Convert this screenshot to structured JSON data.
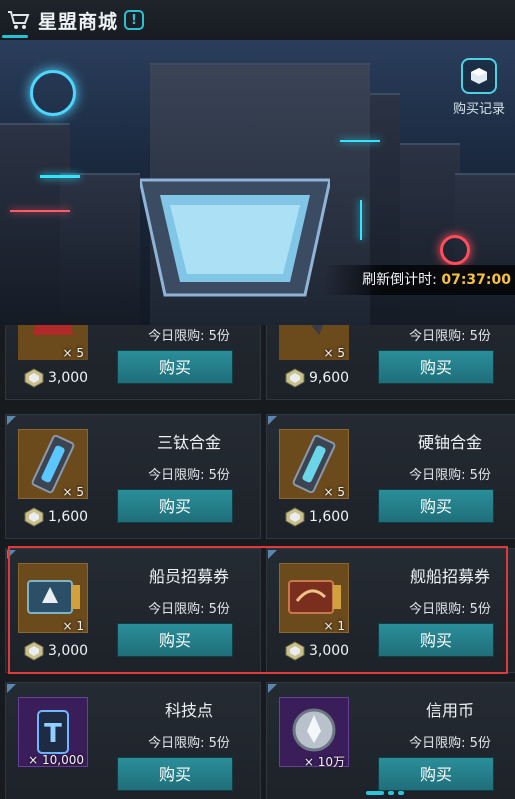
{
  "header": {
    "title": "星盟商城",
    "info_symbol": "!"
  },
  "banner": {
    "purchase_record_label": "购买记录",
    "refresh_label": "刷新倒计时:",
    "refresh_time": "07:37:00"
  },
  "items": [
    {
      "name": "",
      "qty": "× 5",
      "limit": "今日限购: 5份",
      "price": "3,000",
      "buy": "购买",
      "icon": "red-armor-part-icon"
    },
    {
      "name": "",
      "qty": "× 5",
      "limit": "今日限购: 5份",
      "price": "9,600",
      "buy": "购买",
      "icon": "claw-part-icon"
    },
    {
      "name": "三钛合金",
      "qty": "× 5",
      "limit": "今日限购: 5份",
      "price": "1,600",
      "buy": "购买",
      "icon": "titanium-alloy-icon"
    },
    {
      "name": "硬铀合金",
      "qty": "× 5",
      "limit": "今日限购: 5份",
      "price": "1,600",
      "buy": "购买",
      "icon": "uranium-alloy-icon"
    },
    {
      "name": "船员招募券",
      "qty": "× 1",
      "limit": "今日限购: 5份",
      "price": "3,000",
      "buy": "购买",
      "icon": "crew-ticket-icon"
    },
    {
      "name": "舰船招募券",
      "qty": "× 1",
      "limit": "今日限购: 5份",
      "price": "3,000",
      "buy": "购买",
      "icon": "ship-ticket-icon"
    },
    {
      "name": "科技点",
      "qty": "× 10,000",
      "limit": "今日限购: 5份",
      "price": "",
      "buy": "购买",
      "icon": "tech-point-icon"
    },
    {
      "name": "信用币",
      "qty": "× 10万",
      "limit": "今日限购: 5份",
      "price": "",
      "buy": "购买",
      "icon": "credit-coin-icon"
    }
  ],
  "colors": {
    "accent": "#22c3d9",
    "button": "#2a8f9a",
    "timer": "#f7c23b",
    "highlight": "#e0393a"
  }
}
